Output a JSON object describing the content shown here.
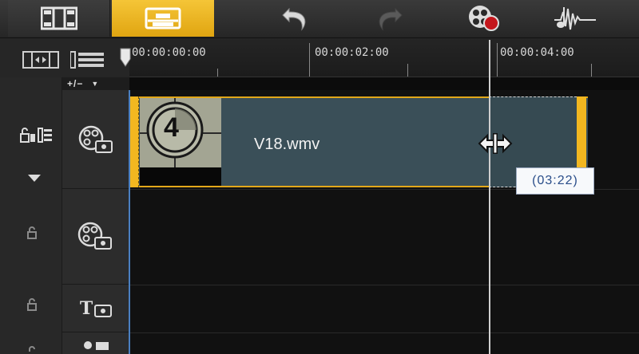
{
  "toolbar": {
    "buttons": [
      {
        "name": "storyboard-view",
        "icon": "film-strip-icon"
      },
      {
        "name": "timeline-view",
        "icon": "timeline-icon",
        "active": true
      },
      {
        "name": "undo",
        "icon": "undo-icon"
      },
      {
        "name": "redo",
        "icon": "redo-icon"
      },
      {
        "name": "record-capture",
        "icon": "record-icon"
      },
      {
        "name": "sound-mixer",
        "icon": "audio-waveform-icon"
      }
    ],
    "accent_color": "#f0b528"
  },
  "ruler": {
    "timecodes": [
      "00:00:00:00",
      "00:00:02:00",
      "00:00:04:00"
    ]
  },
  "track_controls": {
    "add_remove_label": "+/−",
    "expand_icon": "triangle-down-icon"
  },
  "tracks": [
    {
      "name": "video-track",
      "icon": "film-reel-icon"
    },
    {
      "name": "overlay-track",
      "icon": "film-reel-icon"
    },
    {
      "name": "title-track",
      "icon": "title-t-icon",
      "label": "T"
    }
  ],
  "clip": {
    "filename": "V18.wmv",
    "thumbnail_number": "4",
    "border_color": "#e3a81a"
  },
  "tooltip": {
    "duration": "(03:22)"
  }
}
